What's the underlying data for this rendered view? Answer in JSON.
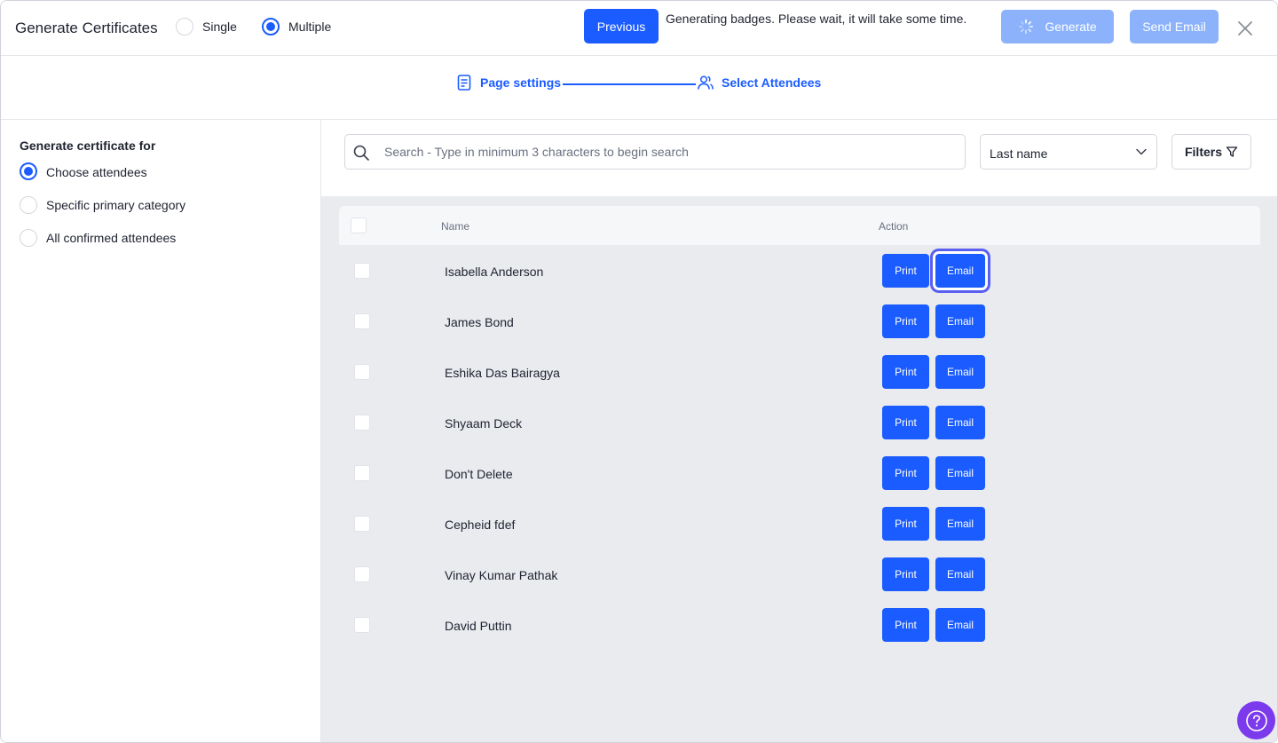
{
  "header": {
    "title": "Generate Certificates",
    "mode_options": [
      {
        "label": "Single",
        "selected": false
      },
      {
        "label": "Multiple",
        "selected": true
      }
    ],
    "previous_label": "Previous",
    "status_message": "Generating badges. Please wait, it will take some time.",
    "generate_label": "Generate",
    "send_email_label": "Send Email"
  },
  "stepper": {
    "steps": [
      {
        "label": "Page settings",
        "icon": "document-icon"
      },
      {
        "label": "Select Attendees",
        "icon": "users-icon"
      }
    ]
  },
  "sidebar": {
    "heading": "Generate certificate for",
    "options": [
      {
        "label": "Choose attendees",
        "selected": true
      },
      {
        "label": "Specific primary category",
        "selected": false
      },
      {
        "label": "All confirmed attendees",
        "selected": false
      }
    ]
  },
  "search": {
    "placeholder": "Search - Type in minimum 3 characters to begin search",
    "value": ""
  },
  "sort": {
    "selected": "Last name"
  },
  "filters_label": "Filters",
  "table": {
    "columns": {
      "name": "Name",
      "action": "Action"
    },
    "print_label": "Print",
    "email_label": "Email",
    "rows": [
      "Isabella Anderson",
      "James Bond",
      "Eshika Das Bairagya",
      "Shyaam Deck",
      "Don't Delete",
      "Cepheid fdef",
      "Vinay Kumar Pathak",
      "David Puttin"
    ]
  },
  "colors": {
    "primary": "#1a5cff",
    "primary_disabled": "#8bb2fb",
    "help": "#7c3aed",
    "focus_ring": "#5a5fef"
  }
}
